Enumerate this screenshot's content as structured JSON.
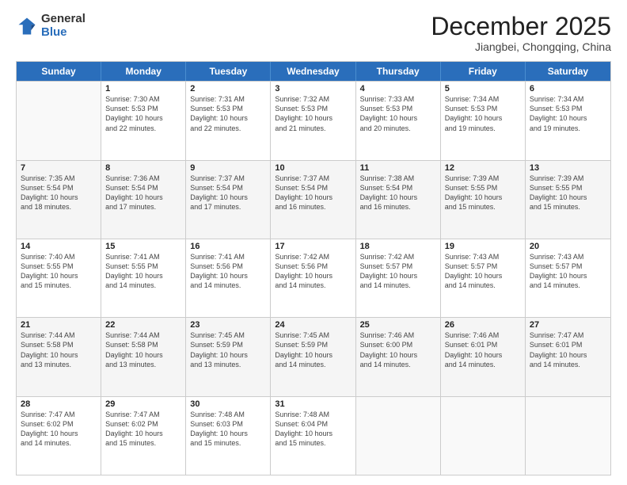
{
  "logo": {
    "general": "General",
    "blue": "Blue"
  },
  "title": "December 2025",
  "location": "Jiangbei, Chongqing, China",
  "weekdays": [
    "Sunday",
    "Monday",
    "Tuesday",
    "Wednesday",
    "Thursday",
    "Friday",
    "Saturday"
  ],
  "rows": [
    [
      {
        "day": "",
        "info": ""
      },
      {
        "day": "1",
        "info": "Sunrise: 7:30 AM\nSunset: 5:53 PM\nDaylight: 10 hours\nand 22 minutes."
      },
      {
        "day": "2",
        "info": "Sunrise: 7:31 AM\nSunset: 5:53 PM\nDaylight: 10 hours\nand 22 minutes."
      },
      {
        "day": "3",
        "info": "Sunrise: 7:32 AM\nSunset: 5:53 PM\nDaylight: 10 hours\nand 21 minutes."
      },
      {
        "day": "4",
        "info": "Sunrise: 7:33 AM\nSunset: 5:53 PM\nDaylight: 10 hours\nand 20 minutes."
      },
      {
        "day": "5",
        "info": "Sunrise: 7:34 AM\nSunset: 5:53 PM\nDaylight: 10 hours\nand 19 minutes."
      },
      {
        "day": "6",
        "info": "Sunrise: 7:34 AM\nSunset: 5:53 PM\nDaylight: 10 hours\nand 19 minutes."
      }
    ],
    [
      {
        "day": "7",
        "info": "Sunrise: 7:35 AM\nSunset: 5:54 PM\nDaylight: 10 hours\nand 18 minutes."
      },
      {
        "day": "8",
        "info": "Sunrise: 7:36 AM\nSunset: 5:54 PM\nDaylight: 10 hours\nand 17 minutes."
      },
      {
        "day": "9",
        "info": "Sunrise: 7:37 AM\nSunset: 5:54 PM\nDaylight: 10 hours\nand 17 minutes."
      },
      {
        "day": "10",
        "info": "Sunrise: 7:37 AM\nSunset: 5:54 PM\nDaylight: 10 hours\nand 16 minutes."
      },
      {
        "day": "11",
        "info": "Sunrise: 7:38 AM\nSunset: 5:54 PM\nDaylight: 10 hours\nand 16 minutes."
      },
      {
        "day": "12",
        "info": "Sunrise: 7:39 AM\nSunset: 5:55 PM\nDaylight: 10 hours\nand 15 minutes."
      },
      {
        "day": "13",
        "info": "Sunrise: 7:39 AM\nSunset: 5:55 PM\nDaylight: 10 hours\nand 15 minutes."
      }
    ],
    [
      {
        "day": "14",
        "info": "Sunrise: 7:40 AM\nSunset: 5:55 PM\nDaylight: 10 hours\nand 15 minutes."
      },
      {
        "day": "15",
        "info": "Sunrise: 7:41 AM\nSunset: 5:55 PM\nDaylight: 10 hours\nand 14 minutes."
      },
      {
        "day": "16",
        "info": "Sunrise: 7:41 AM\nSunset: 5:56 PM\nDaylight: 10 hours\nand 14 minutes."
      },
      {
        "day": "17",
        "info": "Sunrise: 7:42 AM\nSunset: 5:56 PM\nDaylight: 10 hours\nand 14 minutes."
      },
      {
        "day": "18",
        "info": "Sunrise: 7:42 AM\nSunset: 5:57 PM\nDaylight: 10 hours\nand 14 minutes."
      },
      {
        "day": "19",
        "info": "Sunrise: 7:43 AM\nSunset: 5:57 PM\nDaylight: 10 hours\nand 14 minutes."
      },
      {
        "day": "20",
        "info": "Sunrise: 7:43 AM\nSunset: 5:57 PM\nDaylight: 10 hours\nand 14 minutes."
      }
    ],
    [
      {
        "day": "21",
        "info": "Sunrise: 7:44 AM\nSunset: 5:58 PM\nDaylight: 10 hours\nand 13 minutes."
      },
      {
        "day": "22",
        "info": "Sunrise: 7:44 AM\nSunset: 5:58 PM\nDaylight: 10 hours\nand 13 minutes."
      },
      {
        "day": "23",
        "info": "Sunrise: 7:45 AM\nSunset: 5:59 PM\nDaylight: 10 hours\nand 13 minutes."
      },
      {
        "day": "24",
        "info": "Sunrise: 7:45 AM\nSunset: 5:59 PM\nDaylight: 10 hours\nand 14 minutes."
      },
      {
        "day": "25",
        "info": "Sunrise: 7:46 AM\nSunset: 6:00 PM\nDaylight: 10 hours\nand 14 minutes."
      },
      {
        "day": "26",
        "info": "Sunrise: 7:46 AM\nSunset: 6:01 PM\nDaylight: 10 hours\nand 14 minutes."
      },
      {
        "day": "27",
        "info": "Sunrise: 7:47 AM\nSunset: 6:01 PM\nDaylight: 10 hours\nand 14 minutes."
      }
    ],
    [
      {
        "day": "28",
        "info": "Sunrise: 7:47 AM\nSunset: 6:02 PM\nDaylight: 10 hours\nand 14 minutes."
      },
      {
        "day": "29",
        "info": "Sunrise: 7:47 AM\nSunset: 6:02 PM\nDaylight: 10 hours\nand 15 minutes."
      },
      {
        "day": "30",
        "info": "Sunrise: 7:48 AM\nSunset: 6:03 PM\nDaylight: 10 hours\nand 15 minutes."
      },
      {
        "day": "31",
        "info": "Sunrise: 7:48 AM\nSunset: 6:04 PM\nDaylight: 10 hours\nand 15 minutes."
      },
      {
        "day": "",
        "info": ""
      },
      {
        "day": "",
        "info": ""
      },
      {
        "day": "",
        "info": ""
      }
    ]
  ]
}
